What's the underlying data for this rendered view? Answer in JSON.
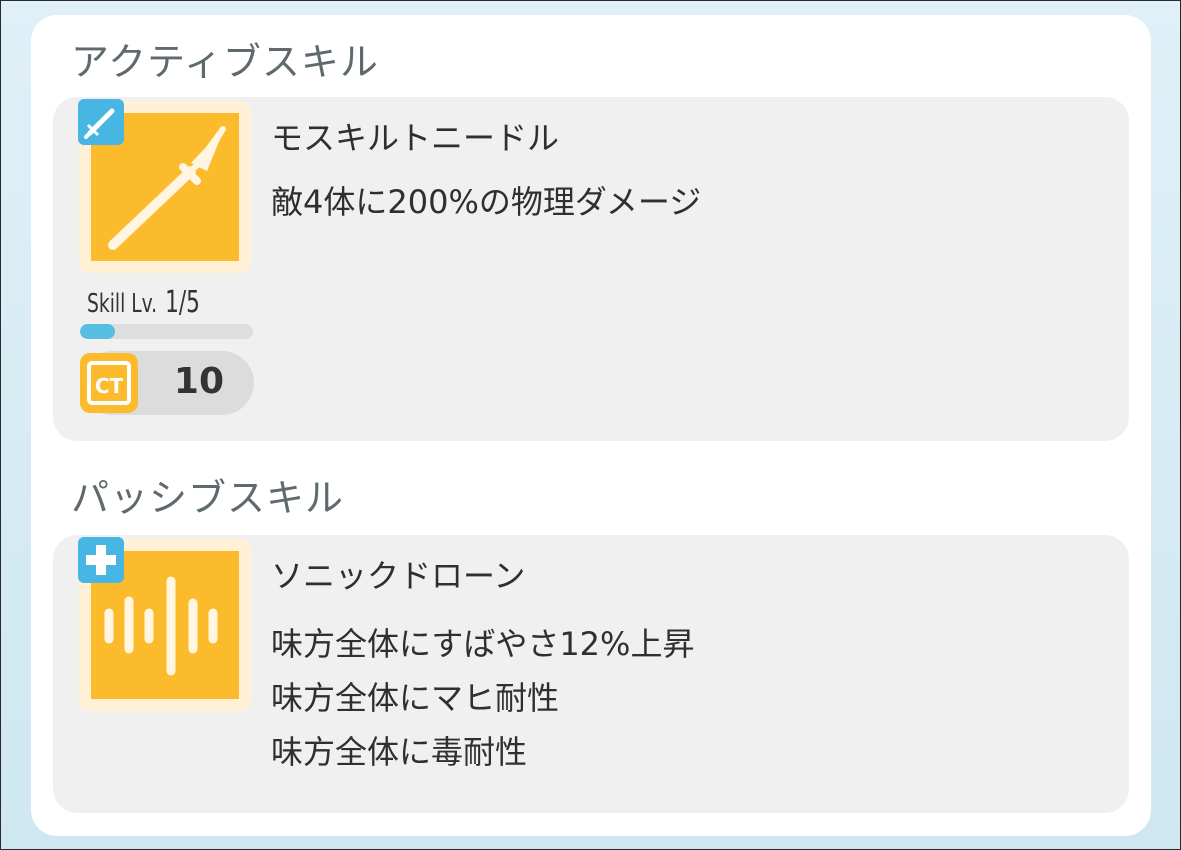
{
  "active_section": {
    "title": "アクティブスキル",
    "skill": {
      "name": "モスキルトニードル",
      "description": "敵4体に200%の物理ダメージ",
      "icon": "spear-icon",
      "badge_icon": "sword-icon",
      "level_label": "Skill Lv.",
      "level_value": "1/5",
      "level_progress": 0.2,
      "ct_icon": "ct-icon",
      "ct_value": "10"
    }
  },
  "passive_section": {
    "title": "パッシブスキル",
    "skill": {
      "name": "ソニックドローン",
      "icon": "sound-wave-icon",
      "badge_icon": "plus-icon",
      "effects": [
        "味方全体にすばやさ12%上昇",
        "味方全体にマヒ耐性",
        "味方全体に毒耐性"
      ]
    }
  },
  "colors": {
    "accent_blue": "#48b6e3",
    "icon_orange": "#fbbb2d",
    "card_bg": "#f0f0f0"
  }
}
